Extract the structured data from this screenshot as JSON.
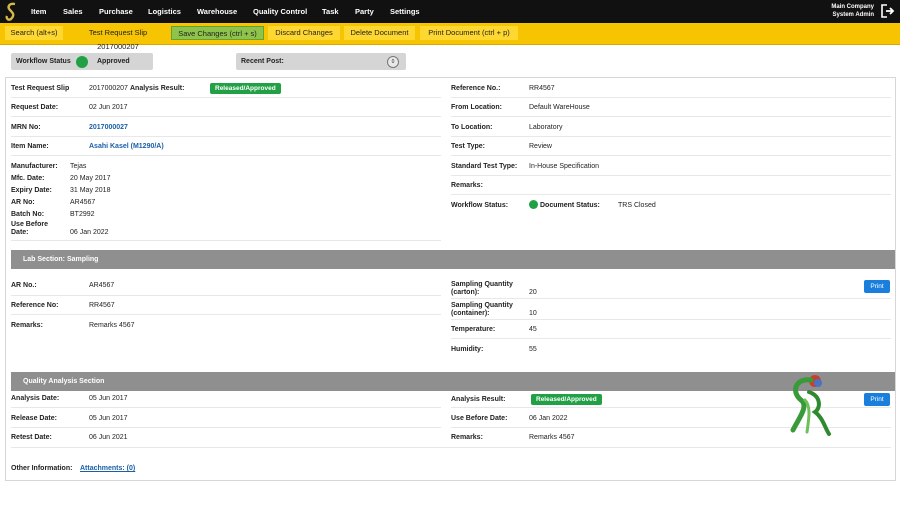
{
  "nav": {
    "items": [
      "Item",
      "Sales",
      "Purchase",
      "Logistics",
      "Warehouse",
      "Quality Control",
      "Task",
      "Party",
      "Settings"
    ],
    "company": "Main Company",
    "user": "System Admin"
  },
  "toolbar": {
    "search": "Search (alt+s)",
    "title": "Test Request Slip 2017000207",
    "save": "Save Changes (ctrl + s)",
    "discard": "Discard Changes",
    "delete": "Delete Document",
    "print": "Print Document (ctrl + p)"
  },
  "status": {
    "workflow_label": "Workflow Status",
    "workflow_value": "Approved",
    "recent_label": "Recent Post:",
    "recent_count": "0"
  },
  "header": {
    "slip_label": "Test Request Slip",
    "slip_no": "2017000207",
    "analysis_label": "Analysis Result:",
    "analysis_value": "Released/Approved",
    "request_date_label": "Request Date:",
    "request_date": "02 Jun 2017",
    "mrn_label": "MRN No:",
    "mrn": "2017000027",
    "item_label": "Item Name:",
    "item": "Asahi Kasel (M1290/A)",
    "manufacturer_label": "Manufacturer:",
    "manufacturer": "Tejas",
    "mfc_label": "Mfc. Date:",
    "mfc": "20 May 2017",
    "expiry_label": "Expiry Date:",
    "expiry": "31 May 2018",
    "ar_label": "AR No:",
    "ar": "AR4567",
    "batch_label": "Batch No:",
    "batch": "BT2992",
    "ubd_label_1": "Use Before",
    "ubd_label_2": "Date:",
    "ubd": "06 Jan 2022",
    "ref_label": "Reference No.:",
    "ref": "RR4567",
    "from_label": "From Location:",
    "from": "Default WareHouse",
    "to_label": "To Location:",
    "to": "Laboratory",
    "test_type_label": "Test Type:",
    "test_type": "Review",
    "std_label": "Standard Test Type:",
    "std": "In-House Specification",
    "remarks_label": "Remarks:",
    "wf_label": "Workflow Status:",
    "doc_status_label": "Document Status:",
    "doc_status": "TRS Closed"
  },
  "lab": {
    "title": "Lab Section: Sampling",
    "ar_label": "AR No.:",
    "ar": "AR4567",
    "ref_label": "Reference No:",
    "ref": "RR4567",
    "remarks_label": "Remarks:",
    "remarks": "Remarks 4567",
    "qty_carton_label_1": "Sampling Quantity",
    "qty_carton_label_2": "(carton):",
    "qty_carton": "20",
    "qty_container_label_1": "Sampling Quantity",
    "qty_container_label_2": "(container):",
    "qty_container": "10",
    "temp_label": "Temperature:",
    "temp": "45",
    "humidity_label": "Humidity:",
    "humidity": "55",
    "print": "Print"
  },
  "qa": {
    "title": "Quality Analysis Section",
    "analysis_date_label": "Analysis Date:",
    "analysis_date": "05 Jun 2017",
    "release_label": "Release Date:",
    "release": "05 Jun 2017",
    "retest_label": "Retest Date:",
    "retest": "06 Jun 2021",
    "result_label": "Analysis Result:",
    "result": "Released/Approved",
    "ubd_label": "Use Before Date:",
    "ubd": "06 Jan 2022",
    "remarks_label": "Remarks:",
    "remarks": "Remarks 4567",
    "print": "Print"
  },
  "footer": {
    "other_label": "Other Information:",
    "attachments": "Attachments: (0)"
  },
  "colors": {
    "accent": "#f6c400",
    "approved": "#22a046",
    "print": "#1a7fdc"
  }
}
